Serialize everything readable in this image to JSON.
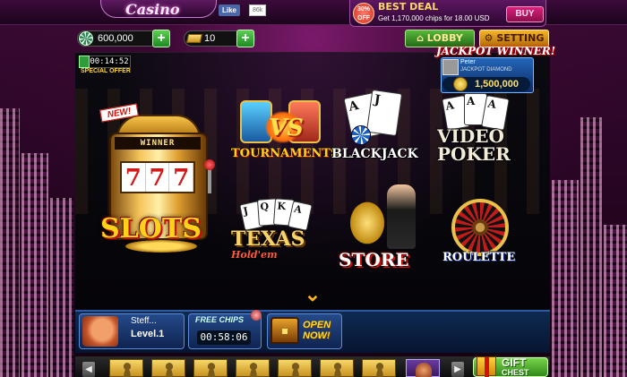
{
  "header": {
    "logo_text": "Casino",
    "fb_like_label": "Like",
    "fb_like_count": "86k",
    "deal": {
      "badge": "30% OFF",
      "title": "BEST DEAL",
      "subtitle": "Get 1,170,000 chips for 18.00 USD",
      "buy_label": "BUY"
    }
  },
  "currency": {
    "chips": "600,000",
    "gold": "10",
    "add_symbol": "+"
  },
  "nav": {
    "lobby_label": "LOBBY",
    "setting_label": "SETTING"
  },
  "special_offer": {
    "timer": "00:14:52",
    "label": "SPECIAL OFFER"
  },
  "jackpot": {
    "title": "JACKPOT WINNER!",
    "winner_name": "Peter",
    "game": "JACKPOT DIAMOND",
    "amount": "1,500,000"
  },
  "games": {
    "slots": {
      "new_badge": "NEW!",
      "winner_sign": "WINNER",
      "reels": [
        "7",
        "7",
        "7"
      ],
      "label": "SLOTS"
    },
    "tournaments": {
      "label": "TOURNAMENTS",
      "vs": "VS"
    },
    "blackjack": {
      "label": "BLACKJACK",
      "cards": [
        "A",
        "J"
      ]
    },
    "video_poker": {
      "label_top": "VIDEO",
      "label_bottom": "POKER",
      "cards": [
        "A",
        "A",
        "A"
      ]
    },
    "texas": {
      "label": "TEXAS",
      "sub": "Hold'em",
      "cards": [
        "J",
        "Q",
        "K",
        "A"
      ]
    },
    "store": {
      "label": "STORE"
    },
    "roulette": {
      "label": "ROULETTE"
    }
  },
  "scroll_arrow": "⌄",
  "profile": {
    "name": "Steff...",
    "level": "Level.1"
  },
  "free_chips": {
    "title": "FREE CHIPS",
    "timer": "00:58:06"
  },
  "open_chest": {
    "label_top": "OPEN",
    "label_bottom": "NOW!"
  },
  "friends": {
    "prev": "◀",
    "next": "▶",
    "gift_label_top": "GIFT",
    "gift_label_bottom": "CHEST"
  },
  "colors": {
    "accent_gold": "#ffd21a",
    "lobby_green": "#58b83a",
    "setting_orange": "#f4b62a",
    "buy_pink": "#d9217a",
    "panel_blue": "#254a8a"
  }
}
